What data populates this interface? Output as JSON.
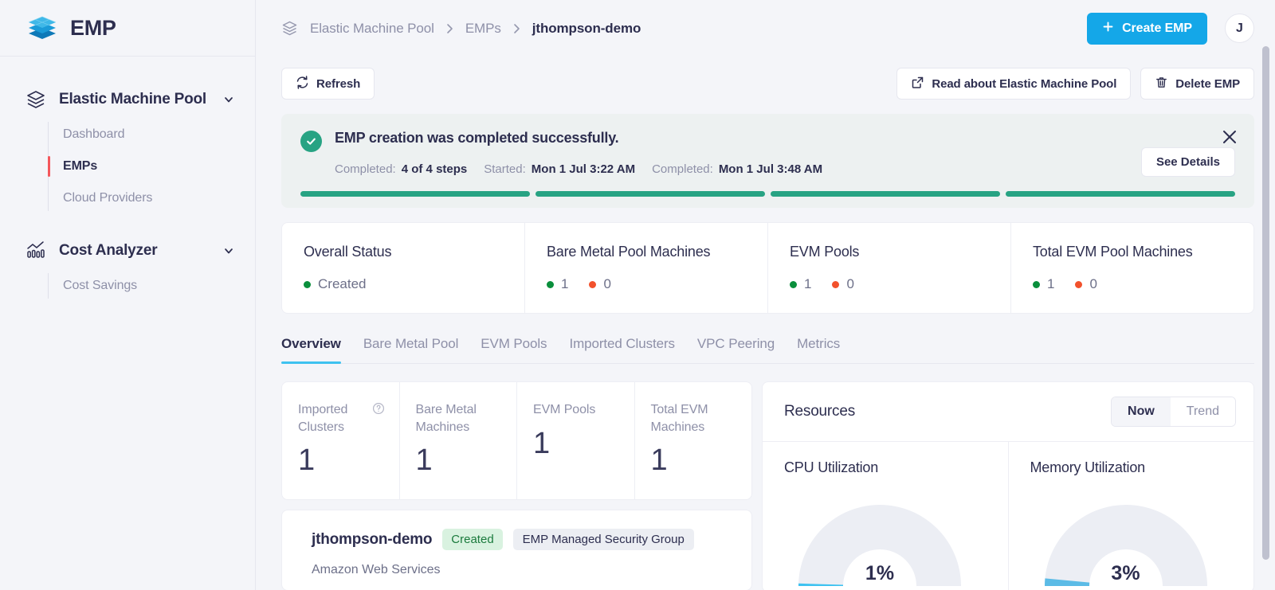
{
  "brand": {
    "title": "EMP",
    "logo_icon": "stacked-layers-logo",
    "accent": "#14a7e8"
  },
  "sidebar": {
    "groups": [
      {
        "label": "Elastic Machine Pool",
        "icon": "layers-icon",
        "chevron": "chevron-down-icon",
        "items": [
          {
            "label": "Dashboard",
            "active": false
          },
          {
            "label": "EMPs",
            "active": true
          },
          {
            "label": "Cloud Providers",
            "active": false
          }
        ]
      },
      {
        "label": "Cost Analyzer",
        "icon": "bar-chart-trend-icon",
        "chevron": "chevron-down-icon",
        "items": [
          {
            "label": "Cost Savings",
            "active": false
          }
        ]
      }
    ],
    "active_indicator_color": "#f4565b"
  },
  "topbar": {
    "breadcrumb_icon": "layers-icon",
    "breadcrumbs": [
      {
        "label": "Elastic Machine Pool"
      },
      {
        "label": "EMPs"
      },
      {
        "label": "jthompson-demo"
      }
    ],
    "separator_icon": "chevron-right-icon",
    "create_button": {
      "label": "Create EMP",
      "icon": "plus-icon"
    },
    "avatar_initial": "J"
  },
  "toolbar": {
    "refresh": {
      "label": "Refresh",
      "icon": "refresh-icon"
    },
    "read_about": {
      "label": "Read about Elastic Machine Pool",
      "icon": "external-link-icon"
    },
    "delete": {
      "label": "Delete EMP",
      "icon": "trash-icon"
    }
  },
  "banner": {
    "status_icon": "check-circle-icon",
    "status_color": "#27a383",
    "title": "EMP creation was completed successfully.",
    "meta": [
      {
        "key": "Completed:",
        "value": "4 of 4 steps"
      },
      {
        "key": "Started:",
        "value": "Mon 1 Jul 3:22 AM"
      },
      {
        "key": "Completed:",
        "value": "Mon 1 Jul 3:48 AM"
      }
    ],
    "see_details_label": "See Details",
    "close_icon": "close-icon",
    "steps_total": 4,
    "steps_complete": 4
  },
  "stat_cards": [
    {
      "title": "Overall Status",
      "kind": "text",
      "dot": "green",
      "text": "Created"
    },
    {
      "title": "Bare Metal Pool Machines",
      "kind": "counts",
      "green": "1",
      "red": "0"
    },
    {
      "title": "EVM Pools",
      "kind": "counts",
      "green": "1",
      "red": "0"
    },
    {
      "title": "Total EVM Pool Machines",
      "kind": "counts",
      "green": "1",
      "red": "0"
    }
  ],
  "tabs": [
    {
      "label": "Overview",
      "active": true
    },
    {
      "label": "Bare Metal Pool",
      "active": false
    },
    {
      "label": "EVM Pools",
      "active": false
    },
    {
      "label": "Imported Clusters",
      "active": false
    },
    {
      "label": "VPC Peering",
      "active": false
    },
    {
      "label": "Metrics",
      "active": false
    }
  ],
  "mini_cards": [
    {
      "title": "Imported Clusters",
      "value": "1",
      "help_icon": "help-circle-icon"
    },
    {
      "title": "Bare Metal Machines",
      "value": "1",
      "help_icon": null
    },
    {
      "title": "EVM Pools",
      "value": "1",
      "help_icon": null
    },
    {
      "title": "Total EVM Machines",
      "value": "1",
      "help_icon": null
    }
  ],
  "emp_card": {
    "name": "jthompson-demo",
    "status_badge": "Created",
    "security_badge": "EMP Managed Security Group",
    "provider": "Amazon Web Services"
  },
  "resources": {
    "title": "Resources",
    "toggle": [
      {
        "label": "Now",
        "active": true
      },
      {
        "label": "Trend",
        "active": false
      }
    ]
  },
  "chart_data": [
    {
      "type": "gauge",
      "title": "CPU Utilization",
      "value": 1,
      "value_label": "1%",
      "min": 0,
      "max": 100,
      "arc_color": "#3ec2f0",
      "track_color": "#eceef4"
    },
    {
      "type": "gauge",
      "title": "Memory Utilization",
      "value": 3,
      "value_label": "3%",
      "min": 0,
      "max": 100,
      "arc_color": "#5bbbe6",
      "track_color": "#eceef4"
    }
  ]
}
